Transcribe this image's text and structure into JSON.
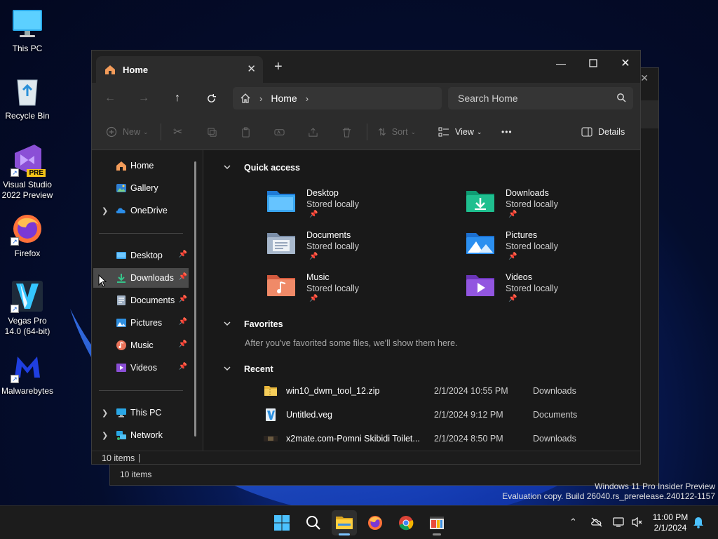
{
  "desktop": {
    "icons": [
      {
        "label": "This PC"
      },
      {
        "label": "Recycle Bin"
      },
      {
        "label": "Visual Studio 2022 Preview",
        "badge": "PRE"
      },
      {
        "label": "Firefox"
      },
      {
        "label": "Vegas Pro 14.0 (64-bit)"
      },
      {
        "label": "Malwarebytes"
      }
    ]
  },
  "background_window": {
    "status": "10 items"
  },
  "explorer": {
    "tab_title": "Home",
    "breadcrumb": "Home",
    "search_placeholder": "Search Home",
    "commands": {
      "new": "New",
      "sort": "Sort",
      "view": "View",
      "more": "•••",
      "details": "Details"
    },
    "nav": {
      "home": "Home",
      "gallery": "Gallery",
      "onedrive": "OneDrive",
      "desktop": "Desktop",
      "downloads": "Downloads",
      "documents": "Documents",
      "pictures": "Pictures",
      "music": "Music",
      "videos": "Videos",
      "thispc": "This PC",
      "network": "Network"
    },
    "sections": {
      "quick_access": "Quick access",
      "favorites": "Favorites",
      "recent": "Recent"
    },
    "quick_access": [
      {
        "name": "Desktop",
        "sub": "Stored locally"
      },
      {
        "name": "Downloads",
        "sub": "Stored locally"
      },
      {
        "name": "Documents",
        "sub": "Stored locally"
      },
      {
        "name": "Pictures",
        "sub": "Stored locally"
      },
      {
        "name": "Music",
        "sub": "Stored locally"
      },
      {
        "name": "Videos",
        "sub": "Stored locally"
      }
    ],
    "favorites_message": "After you've favorited some files, we'll show them here.",
    "recent": [
      {
        "name": "win10_dwm_tool_12.zip",
        "date": "2/1/2024 10:55 PM",
        "location": "Downloads"
      },
      {
        "name": "Untitled.veg",
        "date": "2/1/2024 9:12 PM",
        "location": "Documents"
      },
      {
        "name": "x2mate.com-Pomni Skibidi Toilet...",
        "date": "2/1/2024 8:50 PM",
        "location": "Downloads"
      }
    ],
    "status": "10 items"
  },
  "watermark": {
    "line1": "Windows 11 Pro Insider Preview",
    "line2": "Evaluation copy. Build 26040.rs_prerelease.240122-1157"
  },
  "taskbar": {
    "time": "11:00 PM",
    "date": "2/1/2024"
  },
  "colors": {
    "accent": "#4cc2ff",
    "window_bg": "#191919",
    "chrome_bg": "#2c2c2c"
  }
}
